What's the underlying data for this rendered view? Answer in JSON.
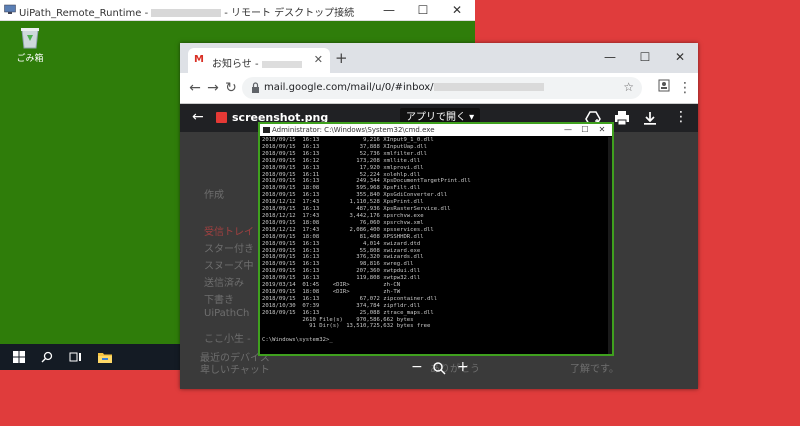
{
  "rdp": {
    "title_prefix": "UiPath_Remote_Runtime -",
    "title_suffix": "- リモート デスクトップ接続",
    "desktop_icon_label": "ごみ箱"
  },
  "chrome": {
    "tab_title": "お知らせ -",
    "url": "mail.google.com/mail/u/0/#inbox/",
    "viewer": {
      "file_name": "screenshot.png",
      "open_with_label": "アプリで開く"
    },
    "gmail_behind": {
      "compose": "作成",
      "items": [
        "受信トレイ",
        "スター付き",
        "スヌーズ中",
        "送信済み",
        "下書き",
        "UiPathCh"
      ],
      "misc": [
        "ここ小生 -",
        "最近のデバイス",
        "卑しいチャット",
        "通話",
        "ありがとう",
        "了解です。"
      ]
    }
  },
  "cmd": {
    "title": "Administrator: C:\\Windows\\System32\\cmd.exe",
    "lines": [
      "2018/09/15  16:13             9,216 XInput9_1_0.dll",
      "2018/09/15  16:13            37,888 XInputUap.dll",
      "2018/09/15  16:13            52,736 xmlfilter.dll",
      "2018/09/15  16:12           173,208 xmllite.dll",
      "2018/09/15  16:13            17,920 xmlprovi.dll",
      "2018/09/15  16:11            52,224 xolehlp.dll",
      "2018/09/15  16:13           249,344 XpsDocumentTargetPrint.dll",
      "2018/09/15  18:08           595,968 XpsFilt.dll",
      "2018/09/15  16:13           355,840 XpsGdiConverter.dll",
      "2018/12/12  17:43         1,110,528 XpsPrint.dll",
      "2018/09/15  16:13           487,936 XpsRasterService.dll",
      "2018/12/12  17:43         3,442,176 xpsrchvw.exe",
      "2018/09/15  18:08            76,060 xpsrchvw.xml",
      "2018/12/12  17:43         2,086,400 xpsservices.dll",
      "2018/09/15  18:08            81,408 XPSSHHDR.dll",
      "2018/09/15  16:13             4,014 xwizard.dtd",
      "2018/09/15  16:13            55,808 xwizard.exe",
      "2018/09/15  16:13           376,320 xwizards.dll",
      "2018/09/15  16:13            98,816 xwreg.dll",
      "2018/09/15  16:13           207,360 xwtpdui.dll",
      "2018/09/15  16:13           119,808 xwtpw32.dll",
      "2019/03/14  01:45    <DIR>          zh-CN",
      "2018/09/15  18:08    <DIR>          zh-TW",
      "2018/09/15  16:13            67,072 zipcontainer.dll",
      "2018/10/30  07:39           374,784 zipfldr.dll",
      "2018/09/15  16:13            25,088 ztrace_maps.dll",
      "            2610 File(s)    970,586,662 bytes",
      "              91 Dir(s)  13,510,725,632 bytes free",
      "",
      "C:\\Windows\\system32>_"
    ]
  }
}
